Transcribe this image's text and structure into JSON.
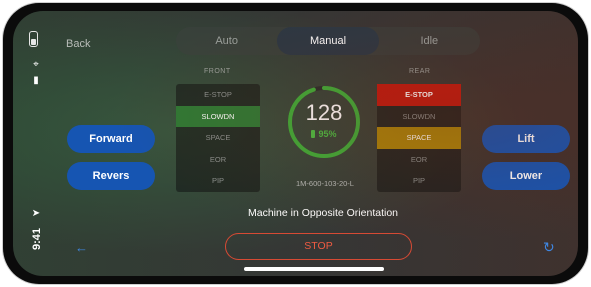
{
  "status": {
    "time": "9:41",
    "battery_level": 0.45
  },
  "nav": {
    "back_label": "Back"
  },
  "modes": {
    "tabs": [
      "Auto",
      "Manual",
      "Idle"
    ],
    "selected": "Manual"
  },
  "front": {
    "label": "FRONT",
    "items": [
      "E-STOP",
      "SLOWDN",
      "SPACE",
      "EOR",
      "PIP"
    ],
    "highlight_colors": {
      "SLOWDN": "#2f7a35"
    }
  },
  "rear": {
    "label": "REAR",
    "items": [
      "E-STOP",
      "SLOWDN",
      "SPACE",
      "EOR",
      "PIP"
    ],
    "highlight_colors": {
      "E-STOP": "#c01b10",
      "SPACE": "#a9850b"
    }
  },
  "controls": {
    "forward": "Forward",
    "reverse": "Revers",
    "lift": "Lift",
    "lower": "Lower"
  },
  "gauge": {
    "value": "128",
    "battery_percent": "95%",
    "battery_fraction": 0.95,
    "ring_color": "#3fae3a"
  },
  "machine_id": "1M-600-103-20-L",
  "orientation_message": "Machine in Opposite Orientation",
  "stop_label": "STOP",
  "icons": {
    "back_arrow": "arrow-left-icon",
    "reset": "refresh-icon",
    "location": "location-arrow-icon",
    "wifi": "wifi-icon",
    "cellular": "cellular-icon",
    "battery": "battery-icon"
  }
}
